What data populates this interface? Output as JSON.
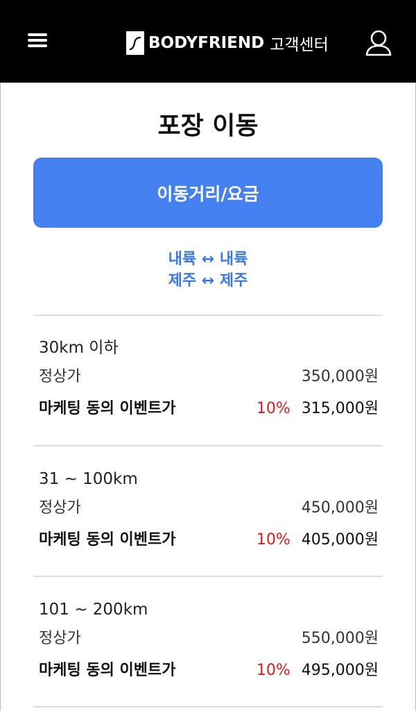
{
  "header": {
    "brand_name": "BODYFRIEND",
    "brand_sub": "고객센터"
  },
  "page": {
    "title": "포장 이동",
    "tab_label": "이동거리/요금",
    "routes": [
      "내륙 ↔ 내륙",
      "제주 ↔ 제주"
    ]
  },
  "sections": [
    {
      "range": "30km 이하",
      "regular_label": "정상가",
      "regular_price": "350,000원",
      "event_label": "마케팅 동의 이벤트가",
      "discount": "10%",
      "event_price": "315,000원"
    },
    {
      "range": "31 ~ 100km",
      "regular_label": "정상가",
      "regular_price": "450,000원",
      "event_label": "마케팅 동의 이벤트가",
      "discount": "10%",
      "event_price": "405,000원"
    },
    {
      "range": "101 ~ 200km",
      "regular_label": "정상가",
      "regular_price": "550,000원",
      "event_label": "마케팅 동의 이벤트가",
      "discount": "10%",
      "event_price": "495,000원"
    }
  ],
  "colors": {
    "header_bg": "#000000",
    "accent_blue": "#4580f0",
    "route_blue": "#3a78e6",
    "discount_red": "#e01b1b"
  }
}
